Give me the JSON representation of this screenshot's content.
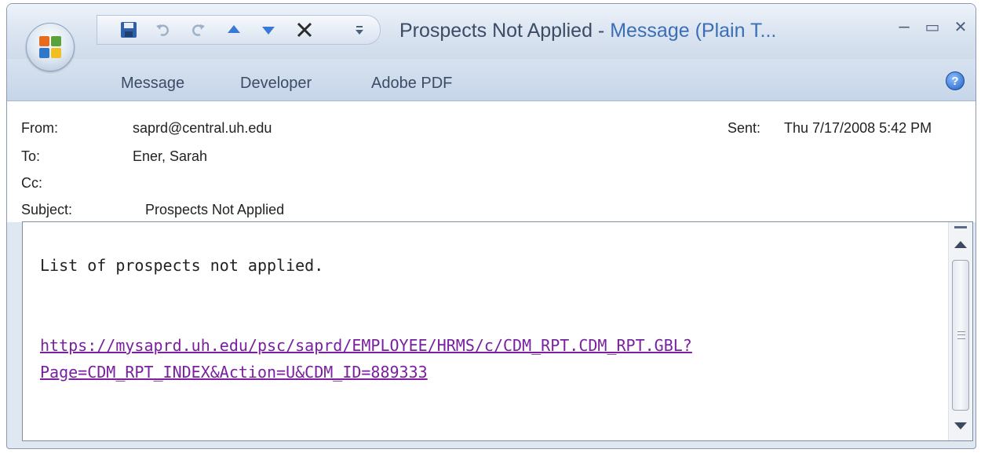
{
  "window": {
    "title_subject": "Prospects Not Applied",
    "title_separator": " - ",
    "title_type": "Message (Plain T...",
    "controls": {
      "minimize": "–",
      "maximize": "▭",
      "close": "✕"
    }
  },
  "quick_access": {
    "icons": [
      "save-icon",
      "undo-icon",
      "redo-icon",
      "previous-item-icon",
      "next-item-icon",
      "delete-icon",
      "customize-dropdown-icon"
    ]
  },
  "ribbon": {
    "tabs": [
      "Message",
      "Developer",
      "Adobe PDF"
    ],
    "help": "?"
  },
  "header": {
    "from_label": "From:",
    "from_value": "saprd@central.uh.edu",
    "to_label": "To:",
    "to_value": "Ener, Sarah",
    "cc_label": "Cc:",
    "cc_value": "",
    "subject_label": "Subject:",
    "subject_value": "Prospects Not Applied",
    "sent_label": "Sent:",
    "sent_value": "Thu 7/17/2008 5:42 PM"
  },
  "body": {
    "line1": "List of prospects not applied.",
    "link_line1": "https://mysaprd.uh.edu/psc/saprd/EMPLOYEE/HRMS/c/CDM_RPT.CDM_RPT.GBL?",
    "link_line2": "Page=CDM_RPT_INDEX&Action=U&CDM_ID=889333"
  },
  "colors": {
    "link": "#7a1fa0",
    "title_accent": "#3b6fb5",
    "chrome": "#dfe7f1"
  }
}
